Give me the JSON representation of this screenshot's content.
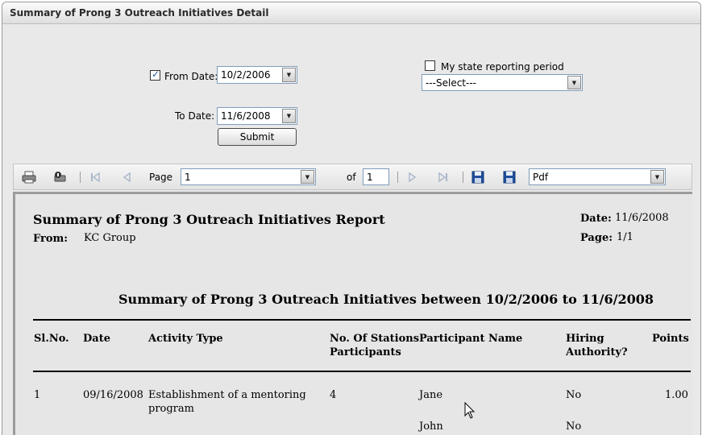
{
  "window": {
    "title": "Summary of Prong 3 Outreach Initiatives Detail"
  },
  "form": {
    "from_label": "From Date:",
    "from_value": "10/2/2006",
    "to_label": "To Date:",
    "to_value": "11/6/2008",
    "submit_label": "Submit",
    "state_period_label": "My state reporting period",
    "state_select_value": "---Select---"
  },
  "toolbar": {
    "page_label": "Page",
    "page_value": "1",
    "of_label": "of",
    "total_pages": "1",
    "export_format": "Pdf",
    "icons": [
      "print-icon",
      "print-setup-icon",
      "first-page-icon",
      "previous-page-icon",
      "next-page-icon",
      "last-page-icon",
      "save-icon",
      "export-icon"
    ]
  },
  "report": {
    "title": "Summary of Prong 3 Outreach Initiatives Report",
    "from_label": "From:",
    "from_value": "KC Group",
    "date_label": "Date:",
    "date_value": "11/6/2008",
    "page_label": "Page:",
    "page_value": "1/1",
    "subtitle": "Summary of Prong 3 Outreach Initiatives between 10/2/2006 to 11/6/2008",
    "columns": {
      "slno": "Sl.No.",
      "date": "Date",
      "activity": "Activity Type",
      "stations_1": "No. Of Stations",
      "stations_2": "Participants",
      "participant": "Participant Name",
      "hiring_1": "Hiring",
      "hiring_2": "Authority?",
      "points": "Points"
    },
    "rows": [
      {
        "slno": "1",
        "date": "09/16/2008",
        "activity_1": "Establishment of a mentoring",
        "activity_2": "program",
        "stations": "4",
        "participants": [
          "Jane",
          "John"
        ],
        "hiring": [
          "No",
          "No"
        ],
        "points": "1.00"
      }
    ]
  }
}
